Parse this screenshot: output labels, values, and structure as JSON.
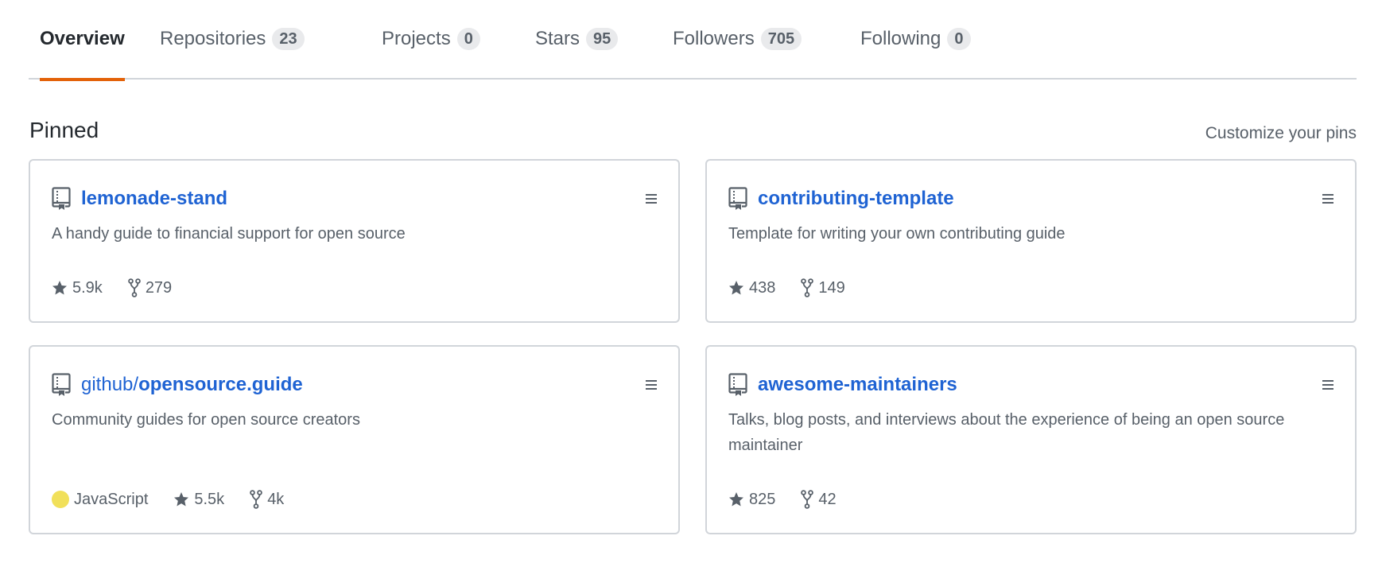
{
  "tabs": [
    {
      "label": "Overview",
      "count": null,
      "active": true
    },
    {
      "label": "Repositories",
      "count": "23",
      "active": false
    },
    {
      "label": "Projects",
      "count": "0",
      "active": false
    },
    {
      "label": "Stars",
      "count": "95",
      "active": false
    },
    {
      "label": "Followers",
      "count": "705",
      "active": false
    },
    {
      "label": "Following",
      "count": "0",
      "active": false
    }
  ],
  "colors": {
    "accent": "#e36209",
    "link": "#1f63d3",
    "muted": "#586069",
    "border": "#d1d5da",
    "javascript": "#f1e05a"
  },
  "pinned": {
    "title": "Pinned",
    "customize_label": "Customize your pins",
    "cards": [
      {
        "owner": "",
        "name": "lemonade-stand",
        "description": "A handy guide to financial support for open source",
        "language": null,
        "stars": "5.9k",
        "forks": "279",
        "icons": {
          "repo": "repo-icon",
          "star": "star-icon",
          "fork": "fork-icon",
          "grabber": "grabber-icon"
        }
      },
      {
        "owner": "",
        "name": "contributing-template",
        "description": "Template for writing your own contributing guide",
        "language": null,
        "stars": "438",
        "forks": "149",
        "icons": {
          "repo": "repo-icon",
          "star": "star-icon",
          "fork": "fork-icon",
          "grabber": "grabber-icon"
        }
      },
      {
        "owner": "github/",
        "name": "opensource.guide",
        "description": "Community guides for open source creators",
        "language": "JavaScript",
        "stars": "5.5k",
        "forks": "4k",
        "icons": {
          "repo": "repo-icon",
          "star": "star-icon",
          "fork": "fork-icon",
          "grabber": "grabber-icon"
        }
      },
      {
        "owner": "",
        "name": "awesome-maintainers",
        "description": "Talks, blog posts, and interviews about the experience of being an open source maintainer",
        "language": null,
        "stars": "825",
        "forks": "42",
        "icons": {
          "repo": "repo-icon",
          "star": "star-icon",
          "fork": "fork-icon",
          "grabber": "grabber-icon"
        }
      }
    ]
  }
}
